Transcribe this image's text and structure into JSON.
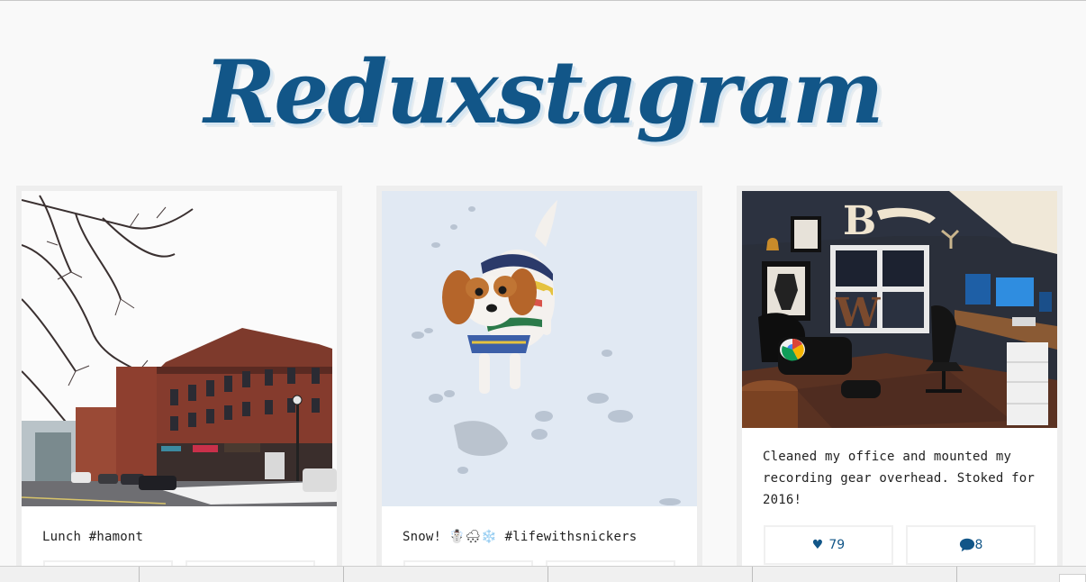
{
  "header": {
    "logo_text": "Reduxstagram"
  },
  "posts": [
    {
      "photo_alt": "Brick storefronts on a snowy street with bare trees",
      "caption": "Lunch #hamont",
      "likes": "",
      "comments": ""
    },
    {
      "photo_alt": "Small spaniel dog in a striped sweater standing in snow",
      "caption": "Snow! ☃️🌨❄️ #lifewithsnickers",
      "likes": "",
      "comments": ""
    },
    {
      "photo_alt": "Home office with desk, monitors, lounge chair and marquee letters",
      "caption": "Cleaned my office and mounted my recording gear overhead. Stoked for 2016!",
      "likes": "79",
      "comments": "8"
    }
  ],
  "icons": {
    "like": "heart-icon",
    "comment": "speech-bubble-icon"
  },
  "colors": {
    "brand": "#125688",
    "background": "#f9f9f9",
    "card_border": "#eeeeee"
  },
  "taskbar": {
    "items": [
      "",
      "",
      "",
      "",
      ""
    ]
  }
}
